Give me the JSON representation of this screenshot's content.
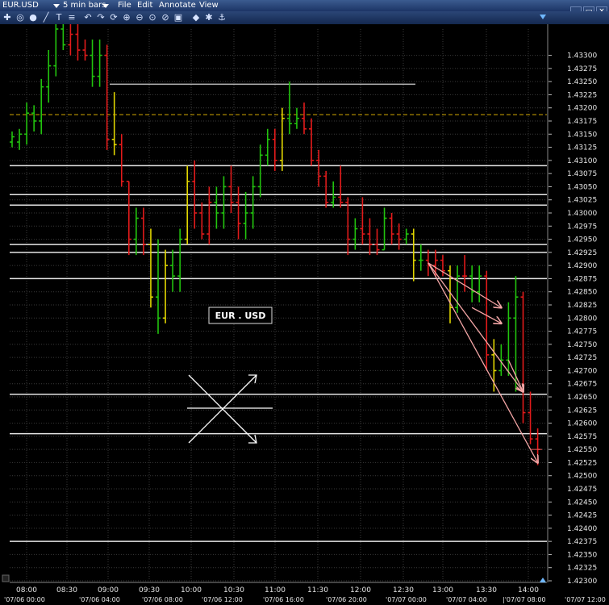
{
  "menubar": {
    "symbol": "EUR.USD",
    "bar_size": "5 min bars",
    "items": [
      "File",
      "Edit",
      "Annotate",
      "View"
    ]
  },
  "toolbar": {
    "icons": [
      "crosshair-icon",
      "circle-icon",
      "circle-solid-icon",
      "trendline-icon",
      "text-icon",
      "fibonacci-icon",
      "undo-icon",
      "redo-icon",
      "refresh-icon",
      "zoom-in-icon",
      "zoom-out-icon",
      "zoom-fit-icon",
      "zoom-reset-icon",
      "zoom-box-icon",
      "color-icon",
      "settings-icon",
      "link-icon"
    ]
  },
  "chart_data": {
    "type": "ohlc",
    "symbol_label": "EUR . USD",
    "colors": {
      "up": "#22c40e",
      "down": "#e21b1b",
      "neutral": "#e0d500",
      "background": "#000000",
      "grid": "#3a3a3a"
    },
    "ylim": [
      1.423,
      1.4335
    ],
    "y_ticks": [
      "1.43300",
      "1.43275",
      "1.43250",
      "1.43225",
      "1.43200",
      "1.43175",
      "1.43150",
      "1.43125",
      "1.43100",
      "1.43075",
      "1.43050",
      "1.43025",
      "1.43000",
      "1.42975",
      "1.42950",
      "1.42925",
      "1.42900",
      "1.42875",
      "1.42850",
      "1.42825",
      "1.42800",
      "1.42775",
      "1.42750",
      "1.42725",
      "1.42700",
      "1.42675",
      "1.42650",
      "1.42625",
      "1.42600",
      "1.42575",
      "1.42550",
      "1.42525",
      "1.42500",
      "1.42475",
      "1.42450",
      "1.42425",
      "1.42400",
      "1.42375",
      "1.42350",
      "1.42325",
      "1.42300"
    ],
    "x_ticks": [
      "08:00",
      "08:30",
      "09:00",
      "09:30",
      "10:00",
      "10:30",
      "11:00",
      "11:30",
      "12:00",
      "12:30",
      "13:00",
      "13:30",
      "14:00"
    ],
    "date_ticks": [
      "'07/06 00:00",
      "'07/06 04:00",
      "'07/06 08:00",
      "'07/06 12:00",
      "'07/06 16:00",
      "'07/06 20:00",
      "'07/07 00:00",
      "'07/07 04:00",
      "|'07/07 08:00",
      "'07/07 12:00"
    ],
    "horizontal_lines": [
      1.42925,
      1.42875,
      1.42655,
      1.4258,
      1.42375,
      1.4309,
      1.43035,
      1.43015,
      1.4294
    ],
    "reference_segment": {
      "price": 1.43245,
      "from": "09:00",
      "to": "12:50"
    },
    "dashed_line": {
      "price": 1.43187,
      "color": "#d4a900"
    },
    "bars": [
      {
        "t": 0,
        "o": 1.43135,
        "h": 1.43155,
        "l": 1.43125,
        "c": 1.43145,
        "d": "up"
      },
      {
        "t": 1,
        "o": 1.43135,
        "h": 1.4316,
        "l": 1.4312,
        "c": 1.4315,
        "d": "up"
      },
      {
        "t": 2,
        "o": 1.4315,
        "h": 1.4321,
        "l": 1.4313,
        "c": 1.4319,
        "d": "up"
      },
      {
        "t": 3,
        "o": 1.4319,
        "h": 1.43205,
        "l": 1.43155,
        "c": 1.43175,
        "d": "up"
      },
      {
        "t": 4,
        "o": 1.43175,
        "h": 1.43255,
        "l": 1.4315,
        "c": 1.4324,
        "d": "up"
      },
      {
        "t": 5,
        "o": 1.4324,
        "h": 1.4331,
        "l": 1.4321,
        "c": 1.4328,
        "d": "up"
      },
      {
        "t": 6,
        "o": 1.4328,
        "h": 1.4337,
        "l": 1.4326,
        "c": 1.4335,
        "d": "up"
      },
      {
        "t": 7,
        "o": 1.4335,
        "h": 1.4337,
        "l": 1.4331,
        "c": 1.4332,
        "d": "up"
      },
      {
        "t": 8,
        "o": 1.4332,
        "h": 1.4338,
        "l": 1.433,
        "c": 1.4334,
        "d": "down"
      },
      {
        "t": 9,
        "o": 1.4334,
        "h": 1.4336,
        "l": 1.4329,
        "c": 1.4331,
        "d": "down"
      },
      {
        "t": 10,
        "o": 1.4331,
        "h": 1.4333,
        "l": 1.4329,
        "c": 1.433,
        "d": "down"
      },
      {
        "t": 11,
        "o": 1.433,
        "h": 1.4333,
        "l": 1.4324,
        "c": 1.4326,
        "d": "up"
      },
      {
        "t": 12,
        "o": 1.4326,
        "h": 1.4333,
        "l": 1.4324,
        "c": 1.433,
        "d": "up"
      },
      {
        "t": 13,
        "o": 1.433,
        "h": 1.4332,
        "l": 1.4312,
        "c": 1.4314,
        "d": "down"
      },
      {
        "t": 14,
        "o": 1.4314,
        "h": 1.4323,
        "l": 1.4311,
        "c": 1.4313,
        "d": "neutral"
      },
      {
        "t": 15,
        "o": 1.4313,
        "h": 1.4315,
        "l": 1.4305,
        "c": 1.4306,
        "d": "down"
      },
      {
        "t": 16,
        "o": 1.4306,
        "h": 1.4306,
        "l": 1.4292,
        "c": 1.4295,
        "d": "down"
      },
      {
        "t": 17,
        "o": 1.4295,
        "h": 1.4301,
        "l": 1.4292,
        "c": 1.4299,
        "d": "up"
      },
      {
        "t": 18,
        "o": 1.4299,
        "h": 1.4301,
        "l": 1.4292,
        "c": 1.4294,
        "d": "down"
      },
      {
        "t": 19,
        "o": 1.4294,
        "h": 1.4297,
        "l": 1.4282,
        "c": 1.4284,
        "d": "neutral"
      },
      {
        "t": 20,
        "o": 1.4284,
        "h": 1.4295,
        "l": 1.4277,
        "c": 1.428,
        "d": "up"
      },
      {
        "t": 21,
        "o": 1.428,
        "h": 1.4293,
        "l": 1.4279,
        "c": 1.429,
        "d": "neutral"
      },
      {
        "t": 22,
        "o": 1.429,
        "h": 1.4293,
        "l": 1.4285,
        "c": 1.4288,
        "d": "up"
      },
      {
        "t": 23,
        "o": 1.4288,
        "h": 1.4297,
        "l": 1.4285,
        "c": 1.4295,
        "d": "up"
      },
      {
        "t": 24,
        "o": 1.4295,
        "h": 1.4309,
        "l": 1.4294,
        "c": 1.4306,
        "d": "neutral"
      },
      {
        "t": 25,
        "o": 1.4306,
        "h": 1.431,
        "l": 1.4297,
        "c": 1.43,
        "d": "down"
      },
      {
        "t": 26,
        "o": 1.43,
        "h": 1.4302,
        "l": 1.4295,
        "c": 1.4296,
        "d": "down"
      },
      {
        "t": 27,
        "o": 1.4296,
        "h": 1.4305,
        "l": 1.4294,
        "c": 1.4302,
        "d": "down"
      },
      {
        "t": 28,
        "o": 1.4302,
        "h": 1.4305,
        "l": 1.4297,
        "c": 1.43,
        "d": "up"
      },
      {
        "t": 29,
        "o": 1.43,
        "h": 1.4307,
        "l": 1.4297,
        "c": 1.4305,
        "d": "up"
      },
      {
        "t": 30,
        "o": 1.4305,
        "h": 1.4309,
        "l": 1.43,
        "c": 1.4302,
        "d": "down"
      },
      {
        "t": 31,
        "o": 1.4302,
        "h": 1.4305,
        "l": 1.4295,
        "c": 1.4298,
        "d": "down"
      },
      {
        "t": 32,
        "o": 1.4298,
        "h": 1.4304,
        "l": 1.4295,
        "c": 1.43,
        "d": "up"
      },
      {
        "t": 33,
        "o": 1.43,
        "h": 1.4307,
        "l": 1.4297,
        "c": 1.4305,
        "d": "up"
      },
      {
        "t": 34,
        "o": 1.4305,
        "h": 1.4313,
        "l": 1.4303,
        "c": 1.4311,
        "d": "up"
      },
      {
        "t": 35,
        "o": 1.4311,
        "h": 1.4316,
        "l": 1.4309,
        "c": 1.4314,
        "d": "up"
      },
      {
        "t": 36,
        "o": 1.4314,
        "h": 1.4316,
        "l": 1.4308,
        "c": 1.431,
        "d": "down"
      },
      {
        "t": 37,
        "o": 1.431,
        "h": 1.432,
        "l": 1.4308,
        "c": 1.4318,
        "d": "neutral"
      },
      {
        "t": 38,
        "o": 1.4318,
        "h": 1.4325,
        "l": 1.4315,
        "c": 1.4317,
        "d": "up"
      },
      {
        "t": 39,
        "o": 1.4317,
        "h": 1.432,
        "l": 1.4316,
        "c": 1.4318,
        "d": "up"
      },
      {
        "t": 40,
        "o": 1.4318,
        "h": 1.4321,
        "l": 1.4315,
        "c": 1.4316,
        "d": "down"
      },
      {
        "t": 41,
        "o": 1.4316,
        "h": 1.4318,
        "l": 1.4309,
        "c": 1.431,
        "d": "down"
      },
      {
        "t": 42,
        "o": 1.431,
        "h": 1.4312,
        "l": 1.4305,
        "c": 1.4307,
        "d": "down"
      },
      {
        "t": 43,
        "o": 1.4307,
        "h": 1.4308,
        "l": 1.4301,
        "c": 1.4302,
        "d": "down"
      },
      {
        "t": 44,
        "o": 1.4302,
        "h": 1.4306,
        "l": 1.4301,
        "c": 1.4303,
        "d": "up"
      },
      {
        "t": 45,
        "o": 1.4303,
        "h": 1.4309,
        "l": 1.4301,
        "c": 1.4302,
        "d": "down"
      },
      {
        "t": 46,
        "o": 1.4302,
        "h": 1.4303,
        "l": 1.4292,
        "c": 1.4295,
        "d": "down"
      },
      {
        "t": 47,
        "o": 1.4295,
        "h": 1.4299,
        "l": 1.4293,
        "c": 1.4297,
        "d": "up"
      },
      {
        "t": 48,
        "o": 1.4297,
        "h": 1.4303,
        "l": 1.4294,
        "c": 1.4296,
        "d": "down"
      },
      {
        "t": 49,
        "o": 1.4296,
        "h": 1.4299,
        "l": 1.4292,
        "c": 1.4294,
        "d": "down"
      },
      {
        "t": 50,
        "o": 1.4294,
        "h": 1.4297,
        "l": 1.4292,
        "c": 1.4293,
        "d": "down"
      },
      {
        "t": 51,
        "o": 1.4293,
        "h": 1.4301,
        "l": 1.4293,
        "c": 1.4299,
        "d": "up"
      },
      {
        "t": 52,
        "o": 1.4299,
        "h": 1.43,
        "l": 1.4294,
        "c": 1.4296,
        "d": "down"
      },
      {
        "t": 53,
        "o": 1.4296,
        "h": 1.4298,
        "l": 1.4293,
        "c": 1.4295,
        "d": "down"
      },
      {
        "t": 54,
        "o": 1.4295,
        "h": 1.4297,
        "l": 1.4294,
        "c": 1.4296,
        "d": "up"
      },
      {
        "t": 55,
        "o": 1.4296,
        "h": 1.4297,
        "l": 1.4287,
        "c": 1.4291,
        "d": "neutral"
      },
      {
        "t": 56,
        "o": 1.4291,
        "h": 1.4294,
        "l": 1.4289,
        "c": 1.4291,
        "d": "up"
      },
      {
        "t": 57,
        "o": 1.4291,
        "h": 1.4293,
        "l": 1.4288,
        "c": 1.429,
        "d": "down"
      },
      {
        "t": 58,
        "o": 1.429,
        "h": 1.4293,
        "l": 1.4288,
        "c": 1.4291,
        "d": "down"
      },
      {
        "t": 59,
        "o": 1.4291,
        "h": 1.4292,
        "l": 1.4288,
        "c": 1.4289,
        "d": "down"
      },
      {
        "t": 60,
        "o": 1.4289,
        "h": 1.429,
        "l": 1.4279,
        "c": 1.4282,
        "d": "neutral"
      },
      {
        "t": 61,
        "o": 1.4282,
        "h": 1.429,
        "l": 1.4281,
        "c": 1.4288,
        "d": "up"
      },
      {
        "t": 62,
        "o": 1.4288,
        "h": 1.4292,
        "l": 1.4285,
        "c": 1.4288,
        "d": "down"
      },
      {
        "t": 63,
        "o": 1.4288,
        "h": 1.429,
        "l": 1.4283,
        "c": 1.4285,
        "d": "up"
      },
      {
        "t": 64,
        "o": 1.4285,
        "h": 1.429,
        "l": 1.4283,
        "c": 1.4288,
        "d": "up"
      },
      {
        "t": 65,
        "o": 1.4288,
        "h": 1.4289,
        "l": 1.427,
        "c": 1.4273,
        "d": "down"
      },
      {
        "t": 66,
        "o": 1.4273,
        "h": 1.4276,
        "l": 1.4266,
        "c": 1.427,
        "d": "neutral"
      },
      {
        "t": 67,
        "o": 1.427,
        "h": 1.4275,
        "l": 1.4269,
        "c": 1.4272,
        "d": "up"
      },
      {
        "t": 68,
        "o": 1.4272,
        "h": 1.4283,
        "l": 1.4269,
        "c": 1.428,
        "d": "up"
      },
      {
        "t": 69,
        "o": 1.428,
        "h": 1.4288,
        "l": 1.4266,
        "c": 1.4284,
        "d": "up"
      },
      {
        "t": 70,
        "o": 1.4284,
        "h": 1.4285,
        "l": 1.426,
        "c": 1.4262,
        "d": "down"
      },
      {
        "t": 71,
        "o": 1.4262,
        "h": 1.4266,
        "l": 1.4256,
        "c": 1.4257,
        "d": "down"
      },
      {
        "t": 72,
        "o": 1.4257,
        "h": 1.4259,
        "l": 1.4252,
        "c": 1.4255,
        "d": "down"
      }
    ],
    "arrows": [
      {
        "from": {
          "t": 57,
          "p": 1.42905
        },
        "to": {
          "t": 67,
          "p": 1.4282
        }
      },
      {
        "from": {
          "t": 57,
          "p": 1.42905
        },
        "to": {
          "t": 70,
          "p": 1.4266
        }
      },
      {
        "from": {
          "t": 57,
          "p": 1.42905
        },
        "to": {
          "t": 72,
          "p": 1.42525
        }
      },
      {
        "from": {
          "t": 63,
          "p": 1.4282
        },
        "to": {
          "t": 67,
          "p": 1.4279
        }
      },
      {
        "from": {
          "t": 68,
          "p": 1.4272
        },
        "to": {
          "t": 70,
          "p": 1.4266
        }
      }
    ],
    "last_price_marker": {
      "price": 1.4255
    }
  }
}
